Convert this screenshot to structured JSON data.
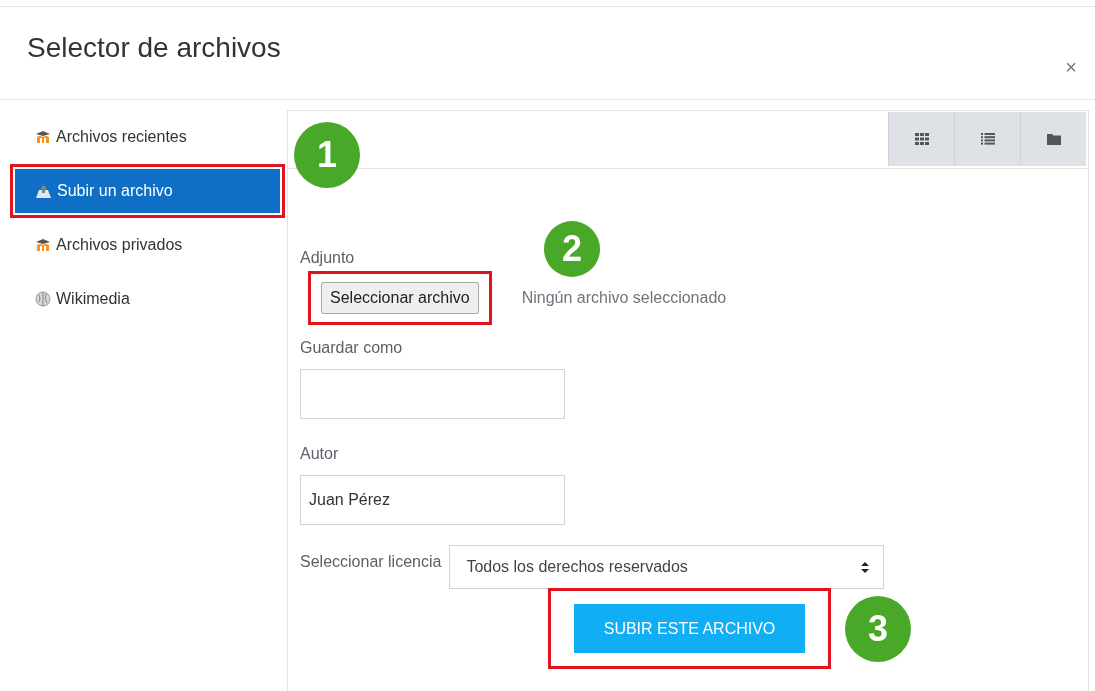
{
  "window": {
    "title": "Selector de archivos",
    "close": "×"
  },
  "sidebar": {
    "items": [
      {
        "label": "Archivos recientes",
        "kind": "moodle",
        "selected": false,
        "highlighted": false
      },
      {
        "label": "Subir un archivo",
        "kind": "upload",
        "selected": true,
        "highlighted": true,
        "step": "1"
      },
      {
        "label": "Archivos privados",
        "kind": "moodle",
        "selected": false,
        "highlighted": false
      },
      {
        "label": "Wikimedia",
        "kind": "globe",
        "selected": false,
        "highlighted": false
      }
    ]
  },
  "toolbar": {
    "buttons": [
      {
        "kind": "grid"
      },
      {
        "kind": "list"
      },
      {
        "kind": "folder"
      }
    ]
  },
  "form": {
    "attachment": {
      "label": "Adjunto",
      "button": "Seleccionar archivo",
      "status": "Ningún archivo seleccionado",
      "highlighted": true,
      "step": "2"
    },
    "save_as": {
      "label": "Guardar como"
    },
    "author": {
      "label": "Autor",
      "value": "Juan Pérez"
    },
    "license": {
      "label": "Seleccionar licencia",
      "value": "Todos los derechos reservados"
    },
    "submit": {
      "label": "SUBIR ESTE ARCHIVO",
      "highlighted": true,
      "step": "3"
    }
  }
}
